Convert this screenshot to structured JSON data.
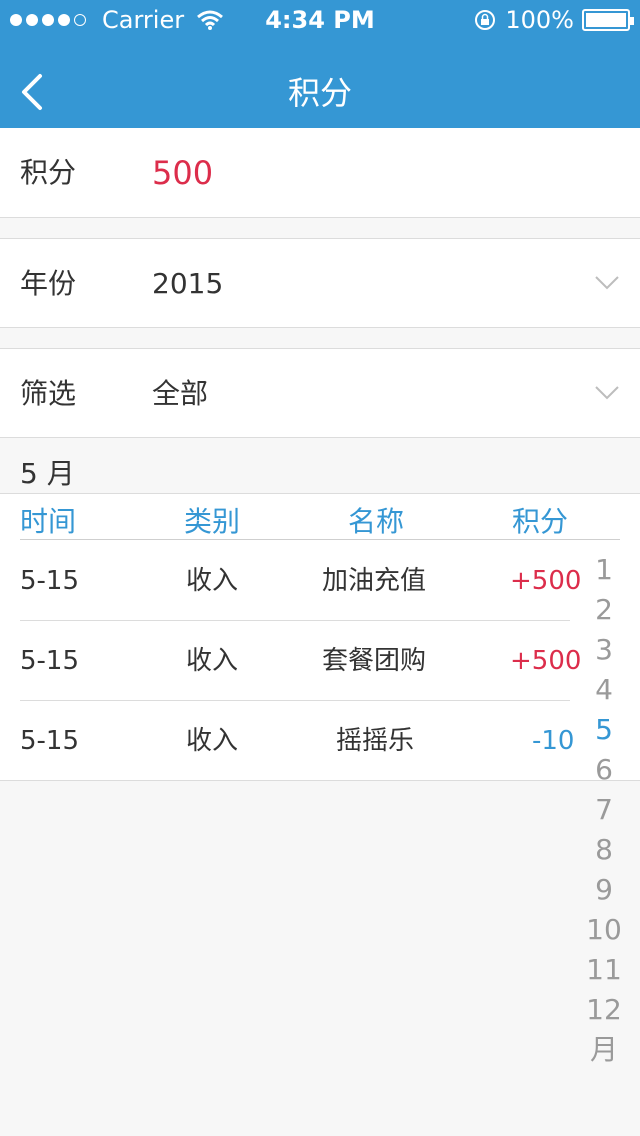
{
  "status_bar": {
    "carrier": "Carrier",
    "time": "4:34 PM",
    "battery": "100%"
  },
  "nav": {
    "title": "积分"
  },
  "points_row": {
    "label": "积分",
    "value": "500"
  },
  "year_row": {
    "label": "年份",
    "value": "2015"
  },
  "filter_row": {
    "label": "筛选",
    "value": "全部"
  },
  "month_header": "5 月",
  "table": {
    "headers": [
      "时间",
      "类别",
      "名称",
      "积分"
    ],
    "rows": [
      {
        "time": "5-15",
        "category": "收入",
        "name": "加油充值",
        "points": "+500"
      },
      {
        "time": "5-15",
        "category": "收入",
        "name": "套餐团购",
        "points": "+500"
      },
      {
        "time": "5-15",
        "category": "收入",
        "name": "摇摇乐",
        "points": "-10"
      }
    ]
  },
  "month_index": [
    "1",
    "2",
    "3",
    "4",
    "5",
    "6",
    "7",
    "8",
    "9",
    "10",
    "11",
    "12",
    "月"
  ],
  "colors": {
    "brand_blue": "#3597d4",
    "points_red": "#dc2d4b"
  }
}
